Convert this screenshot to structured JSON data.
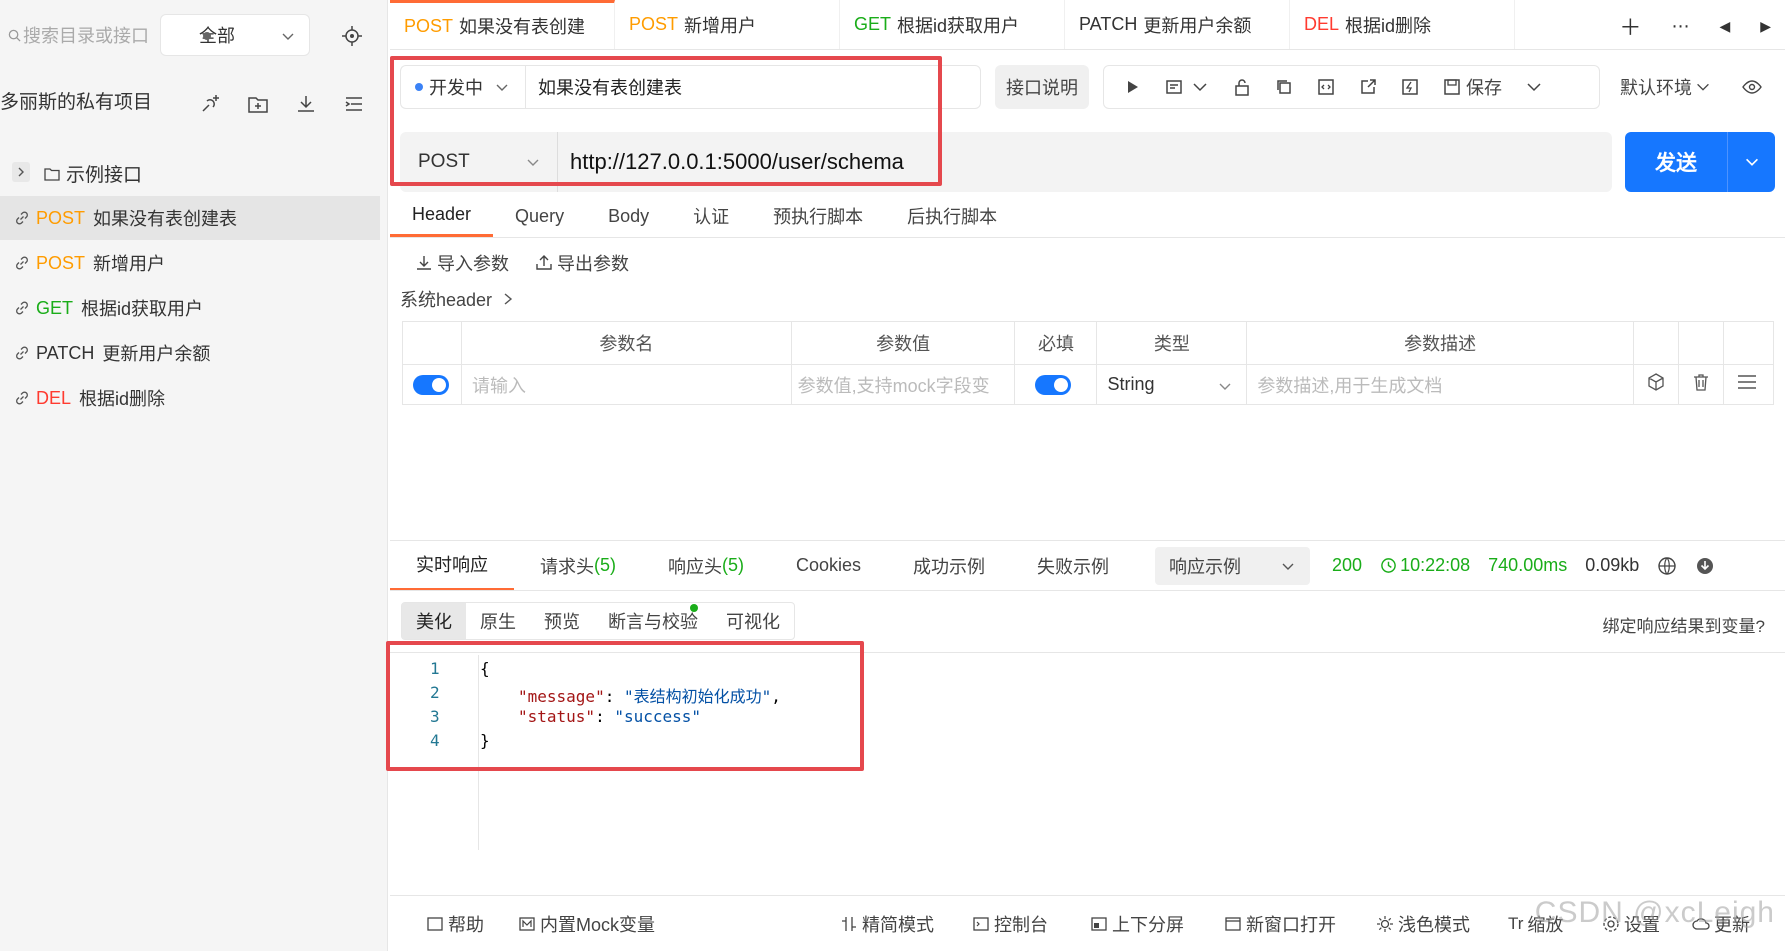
{
  "sidebar": {
    "search_placeholder": "搜索目录或接口",
    "scope": "全部",
    "project_name": "多丽斯的私有项目",
    "folder": "示例接口",
    "items": [
      {
        "method": "POST",
        "label": "如果没有表创建表",
        "color": "#ff9c00"
      },
      {
        "method": "POST",
        "label": "新增用户",
        "color": "#ff9c00"
      },
      {
        "method": "GET",
        "label": "根据id获取用户",
        "color": "#1aad19"
      },
      {
        "method": "PATCH",
        "label": "更新用户余额",
        "color": "#333333"
      },
      {
        "method": "DEL",
        "label": "根据id删除",
        "color": "#ff3b30"
      }
    ]
  },
  "tabs": [
    {
      "method": "POST",
      "label": "如果没有表创建",
      "color": "#ff9c00"
    },
    {
      "method": "POST",
      "label": "新增用户",
      "color": "#ff9c00"
    },
    {
      "method": "GET",
      "label": "根据id获取用户",
      "color": "#1aad19"
    },
    {
      "method": "PATCH",
      "label": "更新用户余额",
      "color": "#333333"
    },
    {
      "method": "DEL",
      "label": "根据id删除",
      "color": "#ff3b30"
    }
  ],
  "request": {
    "status": "开发中",
    "name": "如果没有表创建表",
    "doc_button": "接口说明",
    "save_label": "保存",
    "env": "默认环境",
    "method": "POST",
    "url": "http://127.0.0.1:5000/user/schema",
    "send_label": "发送"
  },
  "subtabs": [
    "Header",
    "Query",
    "Body",
    "认证",
    "预执行脚本",
    "后执行脚本"
  ],
  "params": {
    "import_label": "导入参数",
    "export_label": "导出参数",
    "system_header": "系统header",
    "columns": [
      "参数名",
      "参数值",
      "必填",
      "类型",
      "参数描述"
    ],
    "row": {
      "name_placeholder": "请输入",
      "value_placeholder": "参数值,支持mock字段变",
      "type": "String",
      "desc_placeholder": "参数描述,用于生成文档"
    }
  },
  "response": {
    "tabs": {
      "realtime": "实时响应",
      "req_headers": "请求头",
      "req_headers_count": "(5)",
      "resp_headers": "响应头",
      "resp_headers_count": "(5)",
      "cookies": "Cookies",
      "success_ex": "成功示例",
      "fail_ex": "失败示例"
    },
    "example_select": "响应示例",
    "status_code": "200",
    "time": "10:22:08",
    "duration": "740.00ms",
    "size": "0.09kb",
    "view_tabs": [
      "美化",
      "原生",
      "预览",
      "断言与校验",
      "可视化"
    ],
    "bind_var": "绑定响应结果到变量?",
    "code": {
      "open": "{",
      "key1": "\"message\"",
      "val1": "\"表结构初始化成功\"",
      "key2": "\"status\"",
      "val2": "\"success\"",
      "close": "}",
      "line_numbers": [
        "1",
        "2",
        "3",
        "4"
      ]
    }
  },
  "footer": [
    "帮助",
    "内置Mock变量",
    "精简模式",
    "控制台",
    "上下分屏",
    "新窗口打开",
    "浅色模式",
    "缩放",
    "设置",
    "更新"
  ],
  "watermark": "CSDN @xcLeigh"
}
